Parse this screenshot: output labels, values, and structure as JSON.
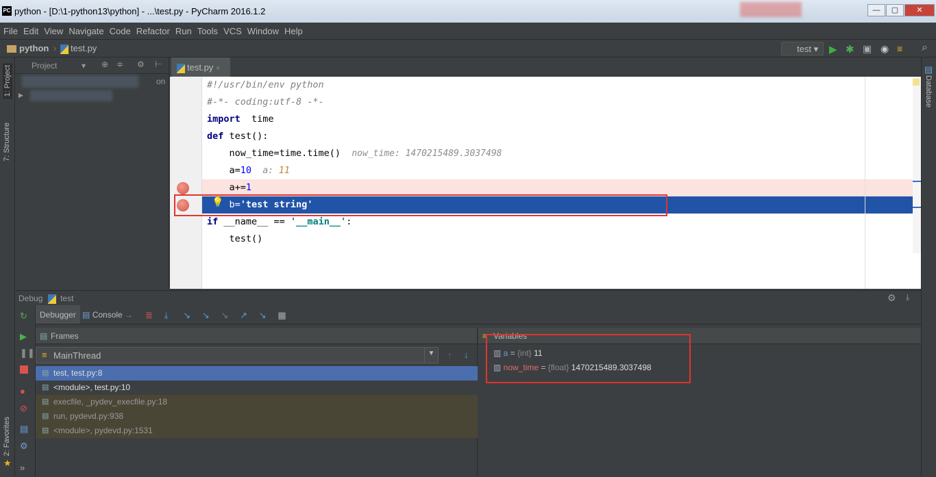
{
  "window": {
    "logo": "PC",
    "title": "python - [D:\\1-python13\\python] - ...\\test.py - PyCharm 2016.1.2",
    "minimize": "—",
    "maximize": "▢",
    "close": "✕"
  },
  "menu": [
    "File",
    "Edit",
    "View",
    "Navigate",
    "Code",
    "Refactor",
    "Run",
    "Tools",
    "VCS",
    "Window",
    "Help"
  ],
  "breadcrumb": {
    "project": "python",
    "file": "test.py"
  },
  "run_config": {
    "label": "test"
  },
  "left_tools": {
    "project": "1: Project",
    "structure": "7: Structure",
    "favorites": "2: Favorites"
  },
  "right_tools": {
    "database": "Database"
  },
  "project_panel": {
    "title": "Project",
    "partial": "on"
  },
  "editor": {
    "tab": "test.py",
    "tab_close": "×",
    "lines": [
      {
        "parts": [
          [
            "cmt",
            "#!/usr/bin/env python"
          ]
        ]
      },
      {
        "parts": [
          [
            "cmt",
            "#-*- coding:utf-8 -*-"
          ]
        ]
      },
      {
        "parts": [
          [
            "kw",
            "import"
          ],
          [
            "",
            "  time"
          ]
        ]
      },
      {
        "parts": [
          [
            "kw",
            "def"
          ],
          [
            "",
            " test():"
          ]
        ]
      },
      {
        "parts": [
          [
            "",
            "    now_time=time.time()  "
          ],
          [
            "hint",
            "now_time: 1470215489.3037498"
          ]
        ]
      },
      {
        "parts": [
          [
            "",
            "    a="
          ],
          [
            "num",
            "10"
          ],
          [
            "",
            "  "
          ],
          [
            "hint",
            "a: "
          ],
          [
            "hintnum",
            "11"
          ]
        ]
      },
      {
        "parts": [
          [
            "",
            "    a+="
          ],
          [
            "num",
            "1"
          ]
        ]
      },
      {
        "parts": [
          [
            "",
            "    b="
          ],
          [
            "strw",
            "'test string'"
          ]
        ]
      },
      {
        "parts": [
          [
            "kw",
            "if"
          ],
          [
            "",
            " __name__ == "
          ],
          [
            "str",
            "'__main__'"
          ],
          [
            "",
            ":"
          ]
        ]
      },
      {
        "parts": [
          [
            "",
            "    test()"
          ]
        ]
      }
    ]
  },
  "debug": {
    "title": "Debug",
    "config": "test",
    "tabs": {
      "debugger": "Debugger",
      "console": "Console"
    },
    "frames_title": "Frames",
    "thread": "MainThread",
    "frames": [
      {
        "label": "test, test.py:8",
        "state": "selected"
      },
      {
        "label": "<module>, test.py:10",
        "state": "normal"
      },
      {
        "label": "execfile, _pydev_execfile.py:18",
        "state": "library"
      },
      {
        "label": "run, pydevd.py:938",
        "state": "library"
      },
      {
        "label": "<module>, pydevd.py:1531",
        "state": "library"
      }
    ],
    "variables_title": "Variables",
    "variables": [
      {
        "name": "a",
        "eq": " = ",
        "type": "{int} ",
        "value": "11",
        "color": "#6a9fd8"
      },
      {
        "name": "now_time",
        "eq": " = ",
        "type": "{float} ",
        "value": "1470215489.3037498",
        "color": "#e06c6c"
      }
    ]
  }
}
